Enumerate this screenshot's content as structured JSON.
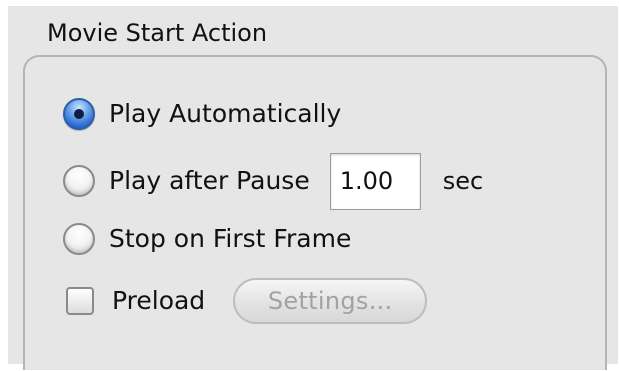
{
  "movie_start_action": {
    "title": "Movie Start Action",
    "options": [
      {
        "label": "Play Automatically",
        "selected": true
      },
      {
        "label": "Play after Pause",
        "selected": false
      },
      {
        "label": "Stop on First Frame",
        "selected": false
      }
    ],
    "pause": {
      "value": "1.00",
      "unit": "sec"
    },
    "preload": {
      "label": "Preload",
      "checked": false
    },
    "settings_button": {
      "label": "Settings...",
      "enabled": false
    }
  },
  "colors": {
    "panel_background": "#e6e6e6",
    "group_border": "#b4b4b4",
    "radio_selected": "#2e6ed4",
    "disabled_text": "#a2a2a2"
  }
}
